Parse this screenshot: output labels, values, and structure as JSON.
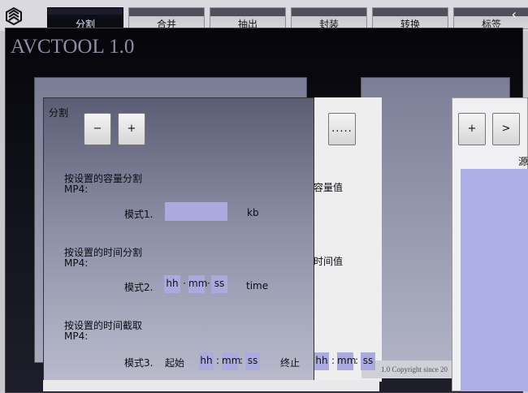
{
  "tabs": [
    {
      "label": "分割",
      "active": true
    },
    {
      "label": "合并",
      "active": false
    },
    {
      "label": "抽出",
      "active": false
    },
    {
      "label": "封装",
      "active": false
    },
    {
      "label": "转换",
      "active": false
    },
    {
      "label": "标签",
      "active": false
    }
  ],
  "close_glyph": "‹",
  "app_title": "AVCTOOL 1.0",
  "split_panel": {
    "title": "分割",
    "minus_label": "−",
    "plus_label": "+",
    "browse_label": ".....",
    "mode1": {
      "heading": "按设置的容量分割",
      "format": "MP4:",
      "label": "模式1.",
      "value": "",
      "unit": "kb",
      "max_label": "最大容量值"
    },
    "mode2": {
      "heading": "按设置的时间分割",
      "format": "MP4:",
      "label": "模式2.",
      "hh": "hh",
      "mm": "mm",
      "ss": "ss",
      "sep1": "·",
      "sep2": "·",
      "unit": "time",
      "max_label": "最大时间值"
    },
    "mode3": {
      "heading": "按设置的时间截取",
      "format": "MP4:",
      "label": "模式3.",
      "start_label": "起始",
      "start": {
        "hh": "hh",
        "mm": "mm",
        "ss": "ss"
      },
      "end_label": "终止",
      "end": {
        "hh": "hh",
        "mm": "mm",
        "ss": "ss"
      },
      "sep": ":"
    }
  },
  "right_panel": {
    "plus_label": "+",
    "next_label": ">",
    "partial_label": "源"
  },
  "copyright": "1.0 Copyright since 20"
}
